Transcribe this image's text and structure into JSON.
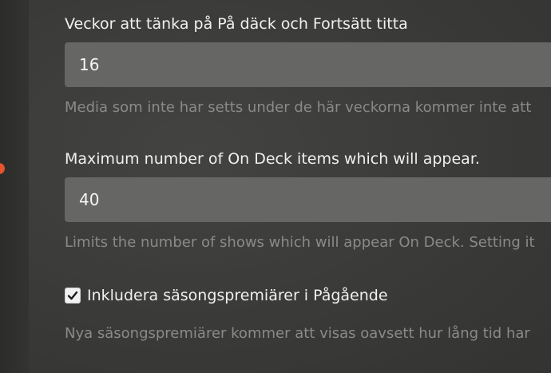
{
  "settings": {
    "weeks_label": "Veckor att tänka på På däck och Fortsätt titta",
    "weeks_value": "16",
    "weeks_help": "Media som inte har setts under de här veckorna kommer inte att",
    "max_items_label": "Maximum number of On Deck items which will appear.",
    "max_items_value": "40",
    "max_items_help": "Limits the number of shows which will appear On Deck. Setting it",
    "season_premieres_checked": true,
    "season_premieres_label": "Inkludera säsongspremiärer i Pågående",
    "season_premieres_help": "Nya säsongspremiärer kommer att visas oavsett hur lång tid har"
  },
  "colors": {
    "background": "#3a3a38",
    "input_background": "#666665",
    "accent": "#e5542f",
    "help_text": "#8a8a88"
  },
  "icons": {
    "checkbox": "checkmark-icon"
  }
}
